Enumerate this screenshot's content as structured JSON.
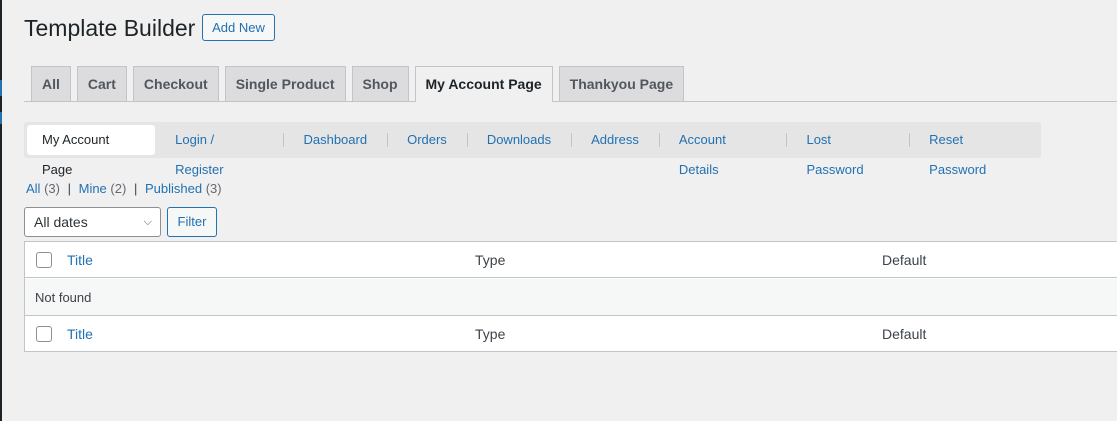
{
  "page": {
    "title": "Template Builder",
    "add_new_label": "Add New"
  },
  "tabs": [
    {
      "label": "All"
    },
    {
      "label": "Cart"
    },
    {
      "label": "Checkout"
    },
    {
      "label": "Single Product"
    },
    {
      "label": "Shop"
    },
    {
      "label": "My Account Page",
      "active": true
    },
    {
      "label": "Thankyou Page"
    }
  ],
  "subnav": [
    {
      "label": "My Account Page",
      "active": true
    },
    {
      "label": "Login / Register"
    },
    {
      "label": "Dashboard"
    },
    {
      "label": "Orders"
    },
    {
      "label": "Downloads"
    },
    {
      "label": "Address"
    },
    {
      "label": "Account Details"
    },
    {
      "label": "Lost Password"
    },
    {
      "label": "Reset Password"
    }
  ],
  "views": {
    "all_label": "All",
    "all_count": "(3)",
    "mine_label": "Mine",
    "mine_count": "(2)",
    "published_label": "Published",
    "published_count": "(3)",
    "separator": "|"
  },
  "filters": {
    "date_selected": "All dates",
    "filter_label": "Filter"
  },
  "table": {
    "columns": {
      "title": "Title",
      "type": "Type",
      "default": "Default"
    },
    "empty_message": "Not found"
  },
  "colors": {
    "accent": "#2271b1",
    "background": "#f0f0f1"
  }
}
